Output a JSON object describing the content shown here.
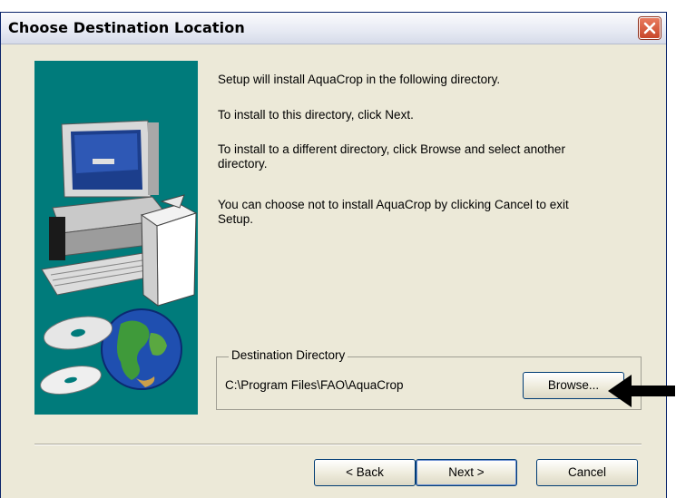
{
  "window": {
    "title": "Choose Destination Location"
  },
  "body": {
    "line1": "Setup will install AquaCrop in the following directory.",
    "line2": "To install to this directory, click Next.",
    "line3a": "To install to a different directory, click Browse and select another",
    "line3b": "directory.",
    "line4a": "You can choose not to install AquaCrop by clicking Cancel to exit",
    "line4b": "Setup."
  },
  "destination": {
    "group_label": "Destination Directory",
    "path": "C:\\Program Files\\FAO\\AquaCrop",
    "browse_label": "Browse..."
  },
  "buttons": {
    "back": "< Back",
    "next": "Next >",
    "cancel": "Cancel"
  },
  "colors": {
    "banner": "#007b7b",
    "close": "#d9532f",
    "frame": "#0A246A"
  },
  "icons": [
    "close-icon",
    "computer-icon",
    "globe-icon",
    "cd-icon",
    "arrow-icon"
  ]
}
